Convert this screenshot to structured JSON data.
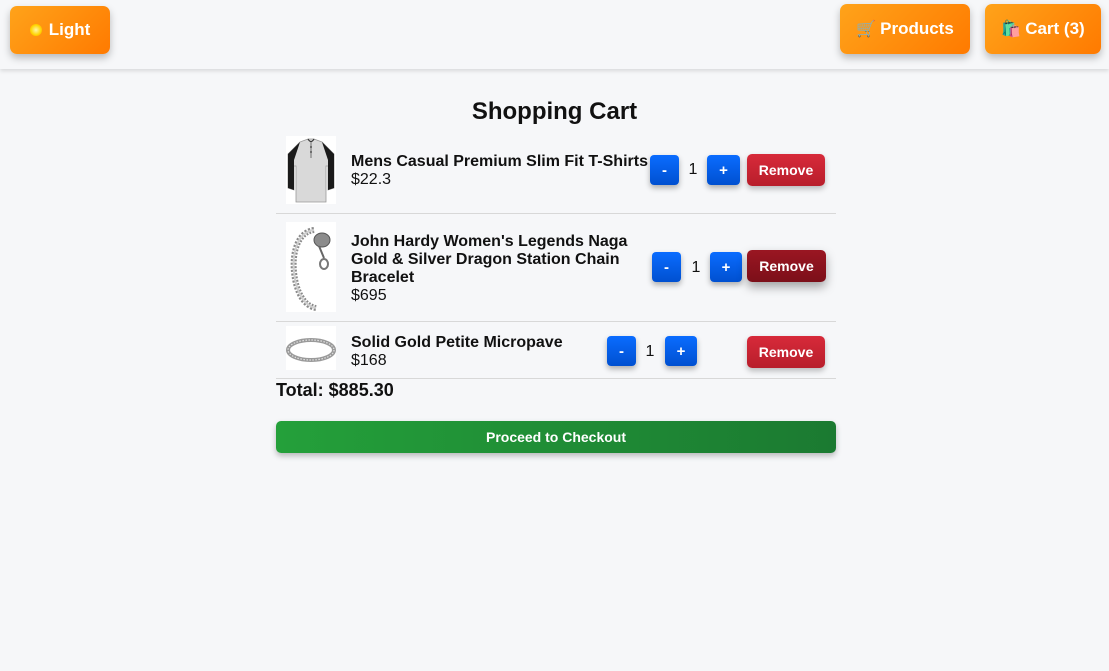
{
  "header": {
    "theme_label": "Light",
    "theme_icon": "sun-icon",
    "products_label": "Products",
    "products_icon": "cart-icon",
    "cart_label": "Cart (3)",
    "cart_icon": "shopping-bag-icon"
  },
  "page": {
    "title": "Shopping Cart"
  },
  "cart": {
    "items": [
      {
        "name": "Mens Casual Premium Slim Fit T-Shirts",
        "price": "$22.3",
        "quantity": "1",
        "image": "t-shirt-image"
      },
      {
        "name": "John Hardy Women's Legends Naga Gold & Silver Dragon Station Chain Bracelet",
        "price": "$695",
        "quantity": "1",
        "image": "bracelet-image"
      },
      {
        "name": "Solid Gold Petite Micropave",
        "price": "$168",
        "quantity": "1",
        "image": "ring-image"
      }
    ],
    "decrement_label": "-",
    "increment_label": "+",
    "remove_label": "Remove",
    "total_label": "Total: $885.30",
    "checkout_label": "Proceed to Checkout"
  },
  "colors": {
    "accent_orange": "#ff8c00",
    "button_blue": "#0a6cff",
    "remove_red": "#c82333",
    "checkout_green": "#1f8f36",
    "background": "#f6f7f9"
  }
}
